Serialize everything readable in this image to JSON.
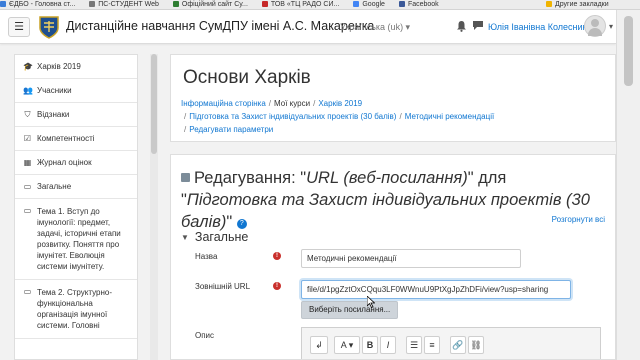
{
  "bookmarks": [
    {
      "label": "ЄДБО - Головна ст...",
      "color": "#3b7dd8"
    },
    {
      "label": "ПС-СТУДЕНТ Web",
      "color": "#777777"
    },
    {
      "label": "Офіційний сайт Су...",
      "color": "#2e7d32"
    },
    {
      "label": "ТОВ «ТЦ РАДО СИ...",
      "color": "#c62828"
    },
    {
      "label": "Google",
      "color": "#4285f4"
    },
    {
      "label": "Facebook",
      "color": "#3b5998"
    },
    {
      "label": "Другие закладки",
      "color": "#f0b400"
    }
  ],
  "navbar": {
    "menu_icon": "☰",
    "site_title": "Дистанційне навчання СумДПУ імені А.С. Макаренка",
    "language": "Українська (uk) ▾",
    "user_name": "Юлія Іванівна Колесник",
    "user_menu_caret": "▾"
  },
  "sidebar": {
    "items": [
      {
        "label": "Харків 2019",
        "icon": "graduation-cap-icon",
        "glyph": "🎓"
      },
      {
        "label": "Учасники",
        "icon": "users-icon",
        "glyph": "👥"
      },
      {
        "label": "Відзнаки",
        "icon": "shield-icon",
        "glyph": "⛉"
      },
      {
        "label": "Компетентності",
        "icon": "checkbox-icon",
        "glyph": "☑"
      },
      {
        "label": "Журнал оцінок",
        "icon": "table-icon",
        "glyph": "▦"
      },
      {
        "label": "Загальне",
        "icon": "folder-icon",
        "glyph": "▭"
      },
      {
        "label": "Тема 1. Вступ до імунології: предмет, задачі, історичні етапи розвитку. Поняття про імунітет. Еволюція системи імунітету.",
        "icon": "folder-icon",
        "glyph": "▭"
      },
      {
        "label": "Тема 2. Структурно-функціональна організація імунної системи. Головні",
        "icon": "folder-icon",
        "glyph": "▭"
      }
    ]
  },
  "header": {
    "page_title": "Основи Харків",
    "breadcrumbs": [
      "Інформаційна сторінка",
      "Мої курси",
      "Харків 2019",
      "Підготовка та Захист індивідуальних проектів (30 балів)",
      "Методичні рекомендації",
      "Редагувати параметри"
    ]
  },
  "form": {
    "heading_prefix": "Редагування: \"",
    "heading_type": "URL (веб-посилання)",
    "heading_middle": "\" для \"",
    "heading_target": "Підготовка та Захист індивідуальних проектів (30 балів)",
    "heading_suffix": "\"",
    "help_glyph": "?",
    "expand_all": "Розгорнути всі",
    "section_title": "Загальне",
    "name_label": "Назва",
    "name_value": "Методичні рекомендації",
    "url_label": "Зовнішній URL",
    "url_value": "file/d/1pgZztOxCQqu3LF0WWnuU9PtXgJpZhDFi/view?usp=sharing",
    "choose_link_label": "Виберіть посилання...",
    "description_label": "Опис",
    "required_glyph": "!"
  },
  "editor_toolbar": [
    {
      "label": "↲",
      "icon": "expand-toolbar-icon"
    },
    {
      "label": "A ▾",
      "icon": "font-style-icon"
    },
    {
      "label": "B",
      "icon": "bold-icon"
    },
    {
      "label": "I",
      "icon": "italic-icon"
    },
    {
      "label": "☰",
      "icon": "bullet-list-icon"
    },
    {
      "label": "≡",
      "icon": "numbered-list-icon"
    },
    {
      "label": "🔗",
      "icon": "link-icon"
    },
    {
      "label": "⛓",
      "icon": "unlink-icon"
    }
  ]
}
